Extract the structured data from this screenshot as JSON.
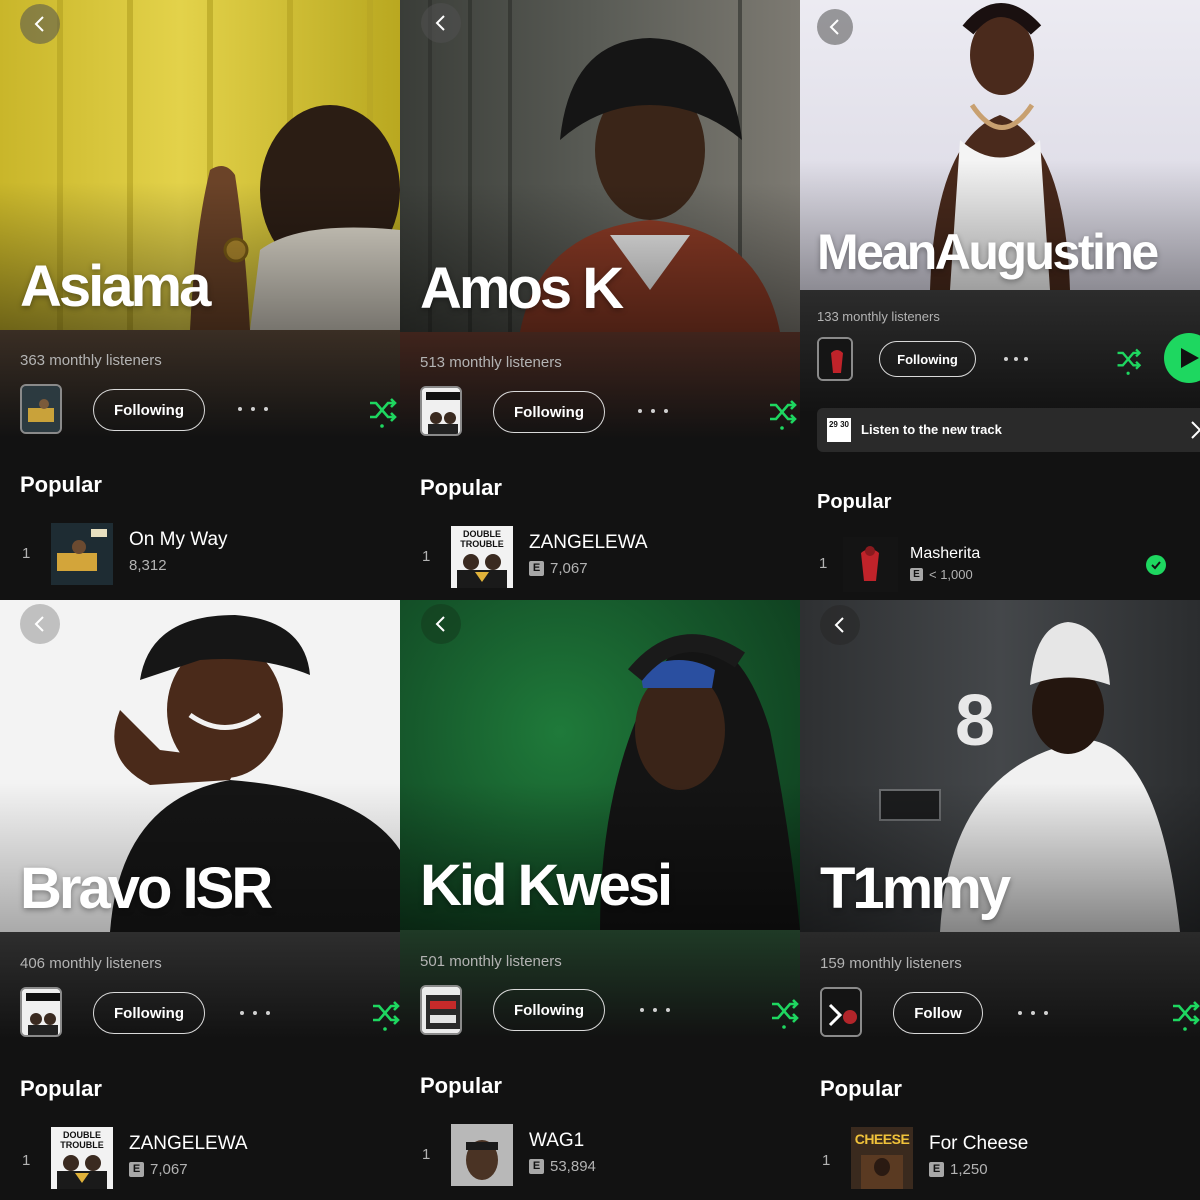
{
  "panels": [
    {
      "artist": "Asiama",
      "listeners": "363 monthly listeners",
      "follow_label": "Following",
      "popular_label": "Popular",
      "track": {
        "number": "1",
        "title": "On My Way",
        "plays": "8,312",
        "explicit": false
      },
      "hero_bg": "#d6c431"
    },
    {
      "artist": "Amos K",
      "listeners": "513 monthly listeners",
      "follow_label": "Following",
      "popular_label": "Popular",
      "track": {
        "number": "1",
        "title": "ZANGELEWA",
        "plays": "7,067",
        "explicit": true,
        "art_text": "DOUBLE TROUBLE"
      },
      "hero_bg": "#4a4a44"
    },
    {
      "artist": "MeanAugustine",
      "listeners": "133 monthly listeners",
      "follow_label": "Following",
      "promo_text": "Listen to the new track",
      "promo_art_text": "29 30",
      "popular_label": "Popular",
      "track": {
        "number": "1",
        "title": "Masherita",
        "plays": "< 1,000",
        "explicit": true,
        "saved": true
      },
      "hero_bg": "#e4e2ec"
    },
    {
      "artist": "Bravo ISR",
      "listeners": "406 monthly listeners",
      "follow_label": "Following",
      "popular_label": "Popular",
      "track": {
        "number": "1",
        "title": "ZANGELEWA",
        "plays": "7,067",
        "explicit": true,
        "art_text": "DOUBLE TROUBLE"
      },
      "hero_bg": "#f2f2f2"
    },
    {
      "artist": "Kid Kwesi",
      "listeners": "501 monthly listeners",
      "follow_label": "Following",
      "popular_label": "Popular",
      "track": {
        "number": "1",
        "title": "WAG1",
        "plays": "53,894",
        "explicit": true
      },
      "hero_bg": "#1a5a2a"
    },
    {
      "artist": "T1mmy",
      "listeners": "159 monthly listeners",
      "follow_label": "Follow",
      "popular_label": "Popular",
      "track": {
        "number": "1",
        "title": "For Cheese",
        "plays": "1,250",
        "explicit": true,
        "art_text": "CHEESE"
      },
      "hero_bg": "#3a3c3e",
      "wall_number": "8"
    }
  ],
  "icons": {
    "back": "chevron-left-icon",
    "shuffle": "shuffle-icon",
    "more": "more-horizontal-icon",
    "play": "play-icon",
    "check": "check-circle-icon"
  },
  "colors": {
    "accent": "#1ed760",
    "background": "#121212",
    "secondary_text": "#b3b3b3"
  }
}
